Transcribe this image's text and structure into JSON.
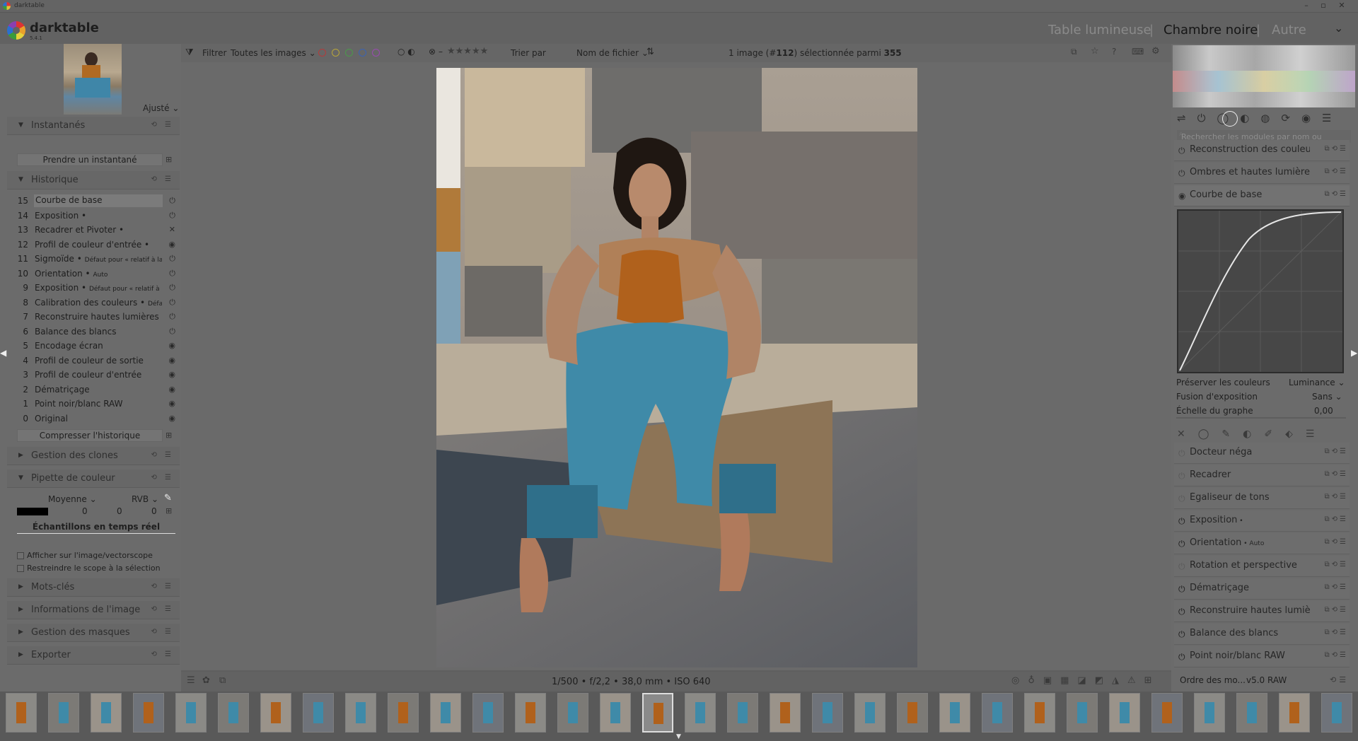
{
  "window": {
    "title": "darktable"
  },
  "header": {
    "app_name": "darktable",
    "version": "5.4.1",
    "views": [
      "Table lumineuse",
      "Chambre noire",
      "Autre"
    ],
    "active_view": "Chambre noire",
    "separator": "|",
    "dropdown_glyph": "⌄"
  },
  "left": {
    "preview_label": "Ajusté",
    "snapshots": {
      "title": "Instantanés",
      "button": "Prendre un instantané"
    },
    "history": {
      "title": "Historique",
      "items": [
        {
          "num": "15",
          "label": "Courbe de base",
          "detail": "",
          "state": "power"
        },
        {
          "num": "14",
          "label": "Exposition •",
          "detail": "",
          "state": "power"
        },
        {
          "num": "13",
          "label": "Recadrer et Pivoter •",
          "detail": "",
          "state": "off"
        },
        {
          "num": "12",
          "label": "Profil de couleur d'entrée •",
          "detail": "",
          "state": "on"
        },
        {
          "num": "11",
          "label": "Sigmoïde •",
          "detail": "Défaut pour « relatif à la s...",
          "state": "power"
        },
        {
          "num": "10",
          "label": "Orientation •",
          "detail": "Auto",
          "state": "power"
        },
        {
          "num": "9",
          "label": "Exposition •",
          "detail": "Défaut pour « relatif à la...",
          "state": "power"
        },
        {
          "num": "8",
          "label": "Calibration des couleurs •",
          "detail": "Défaut p...",
          "state": "power"
        },
        {
          "num": "7",
          "label": "Reconstruire hautes lumières",
          "detail": "",
          "state": "power"
        },
        {
          "num": "6",
          "label": "Balance des blancs",
          "detail": "",
          "state": "power"
        },
        {
          "num": "5",
          "label": "Encodage écran",
          "detail": "",
          "state": "on"
        },
        {
          "num": "4",
          "label": "Profil de couleur de sortie",
          "detail": "",
          "state": "on"
        },
        {
          "num": "3",
          "label": "Profil de couleur d'entrée",
          "detail": "",
          "state": "on"
        },
        {
          "num": "2",
          "label": "Dématriçage",
          "detail": "",
          "state": "on"
        },
        {
          "num": "1",
          "label": "Point noir/blanc RAW",
          "detail": "",
          "state": "on"
        },
        {
          "num": "0",
          "label": "Original",
          "detail": "",
          "state": "on"
        }
      ],
      "compress_button": "Compresser l'historique"
    },
    "clones": {
      "title": "Gestion des clones"
    },
    "picker": {
      "title": "Pipette de couleur",
      "mode": "Moyenne",
      "space": "RVB",
      "values": [
        "0",
        "0",
        "0"
      ],
      "live_button": "Échantillons en temps réel",
      "option1": "Afficher sur l'image/vectorscope",
      "option2": "Restreindre le scope à la sélection"
    },
    "collapsed": [
      "Mots-clés",
      "Informations de l'image",
      "Gestion des masques",
      "Exporter"
    ]
  },
  "toolbar": {
    "filter_label": "Filtrer",
    "filter_value": "Toutes les images",
    "sort_label": "Trier par",
    "sort_value": "Nom de fichier",
    "selection_prefix": "1 image (#",
    "selection_id": "112",
    "selection_mid": ") sélectionnée parmi ",
    "selection_total": "355",
    "rating_stars": "★★★★★",
    "reject_glyph": "⊗",
    "dash": "–"
  },
  "status": {
    "exif": "1/500 • f/2,2 • 38,0 mm • ISO 640"
  },
  "right": {
    "search_placeholder": "Rechercher les modules par nom ou mots-...",
    "modules_top": [
      {
        "label": "Reconstruction des couleu...",
        "detail": ""
      },
      {
        "label": "Ombres et hautes lumières",
        "detail": ""
      }
    ],
    "curve_module": {
      "title": "Courbe de base",
      "preserve_label": "Préserver les couleurs",
      "preserve_value": "Luminance",
      "fusion_label": "Fusion d'exposition",
      "fusion_value": "Sans",
      "scale_label": "Échelle du graphe",
      "scale_value": "0,00"
    },
    "modules_bottom": [
      {
        "label": "Docteur néga",
        "detail": "",
        "on": false
      },
      {
        "label": "Recadrer",
        "detail": "",
        "on": false
      },
      {
        "label": "Égaliseur de tons",
        "detail": "",
        "on": false
      },
      {
        "label": "Exposition",
        "detail": " •",
        "on": true
      },
      {
        "label": "Orientation",
        "detail": " • Auto",
        "on": true
      },
      {
        "label": "Rotation et perspective",
        "detail": "",
        "on": false
      },
      {
        "label": "Dématriçage",
        "detail": "",
        "on": true
      },
      {
        "label": "Reconstruire hautes lumièr...",
        "detail": "",
        "on": true
      },
      {
        "label": "Balance des blancs",
        "detail": "",
        "on": true
      },
      {
        "label": "Point noir/blanc RAW",
        "detail": "",
        "on": true
      }
    ],
    "order_label": "Ordre des mo...",
    "order_value": "v5.0 RAW"
  },
  "colors": {
    "accent_labels": [
      "#b33b3b",
      "#b8a63a",
      "#4a9a4a",
      "#3b63b3",
      "#9a4ab0"
    ]
  }
}
